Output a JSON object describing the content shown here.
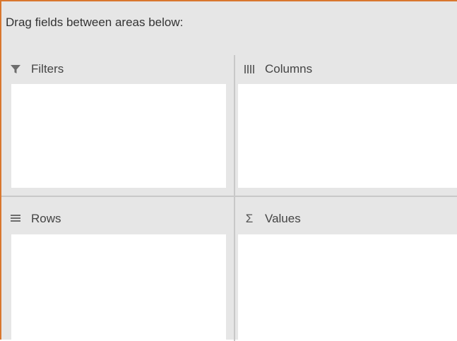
{
  "instruction": "Drag fields between areas below:",
  "areas": {
    "filters": {
      "label": "Filters",
      "icon": "filter-icon"
    },
    "columns": {
      "label": "Columns",
      "icon": "columns-icon"
    },
    "rows": {
      "label": "Rows",
      "icon": "rows-icon"
    },
    "values": {
      "label": "Values",
      "icon": "sigma-icon"
    }
  },
  "colors": {
    "border_accent": "#d9772e",
    "pane_background": "#e6e6e6",
    "drop_zone_background": "#ffffff"
  }
}
